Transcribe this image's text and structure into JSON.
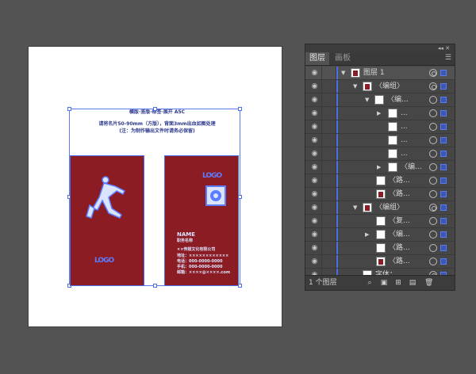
{
  "artboard": {
    "header_line1": "横版·竖版·标签·展开 A5C",
    "header_line2": "请将名片50-90mm（方版），背面3mm出血如图处理",
    "header_line3": "(注：为制作输出文件时请务必保留)",
    "card_back": {
      "logo_text": "LOGO"
    },
    "card_front": {
      "logo_text": "LOGO",
      "name_label": "NAME",
      "title_label": "职务名称",
      "company": "××传媒文化有限公司",
      "line1": "地址：××××××××××××",
      "line2": "电话：000-0000-0000",
      "line3": "手机：000-0000-0000",
      "line4": "邮箱：××××@××××.com"
    }
  },
  "panel": {
    "tab_layers": "图层",
    "tab_artboards": "画板",
    "layer_count": "1 个图层",
    "rows": [
      {
        "name": "图层 1",
        "tri": "▼"
      },
      {
        "name": "〈编组〉",
        "tri": "▼"
      },
      {
        "name": "〈编...",
        "tri": "▼"
      },
      {
        "name": "...",
        "tri": "▶"
      },
      {
        "name": "...",
        "tri": ""
      },
      {
        "name": "...",
        "tri": ""
      },
      {
        "name": "...",
        "tri": ""
      },
      {
        "name": "〈编...",
        "tri": "▶"
      },
      {
        "name": "〈路...",
        "tri": ""
      },
      {
        "name": "〈路...",
        "tri": ""
      },
      {
        "name": "〈编组〉",
        "tri": "▼"
      },
      {
        "name": "〈复...",
        "tri": ""
      },
      {
        "name": "〈编...",
        "tri": "▶"
      },
      {
        "name": "〈路...",
        "tri": ""
      },
      {
        "name": "〈路...",
        "tri": ""
      },
      {
        "name": "字体：...",
        "tri": ""
      }
    ]
  }
}
